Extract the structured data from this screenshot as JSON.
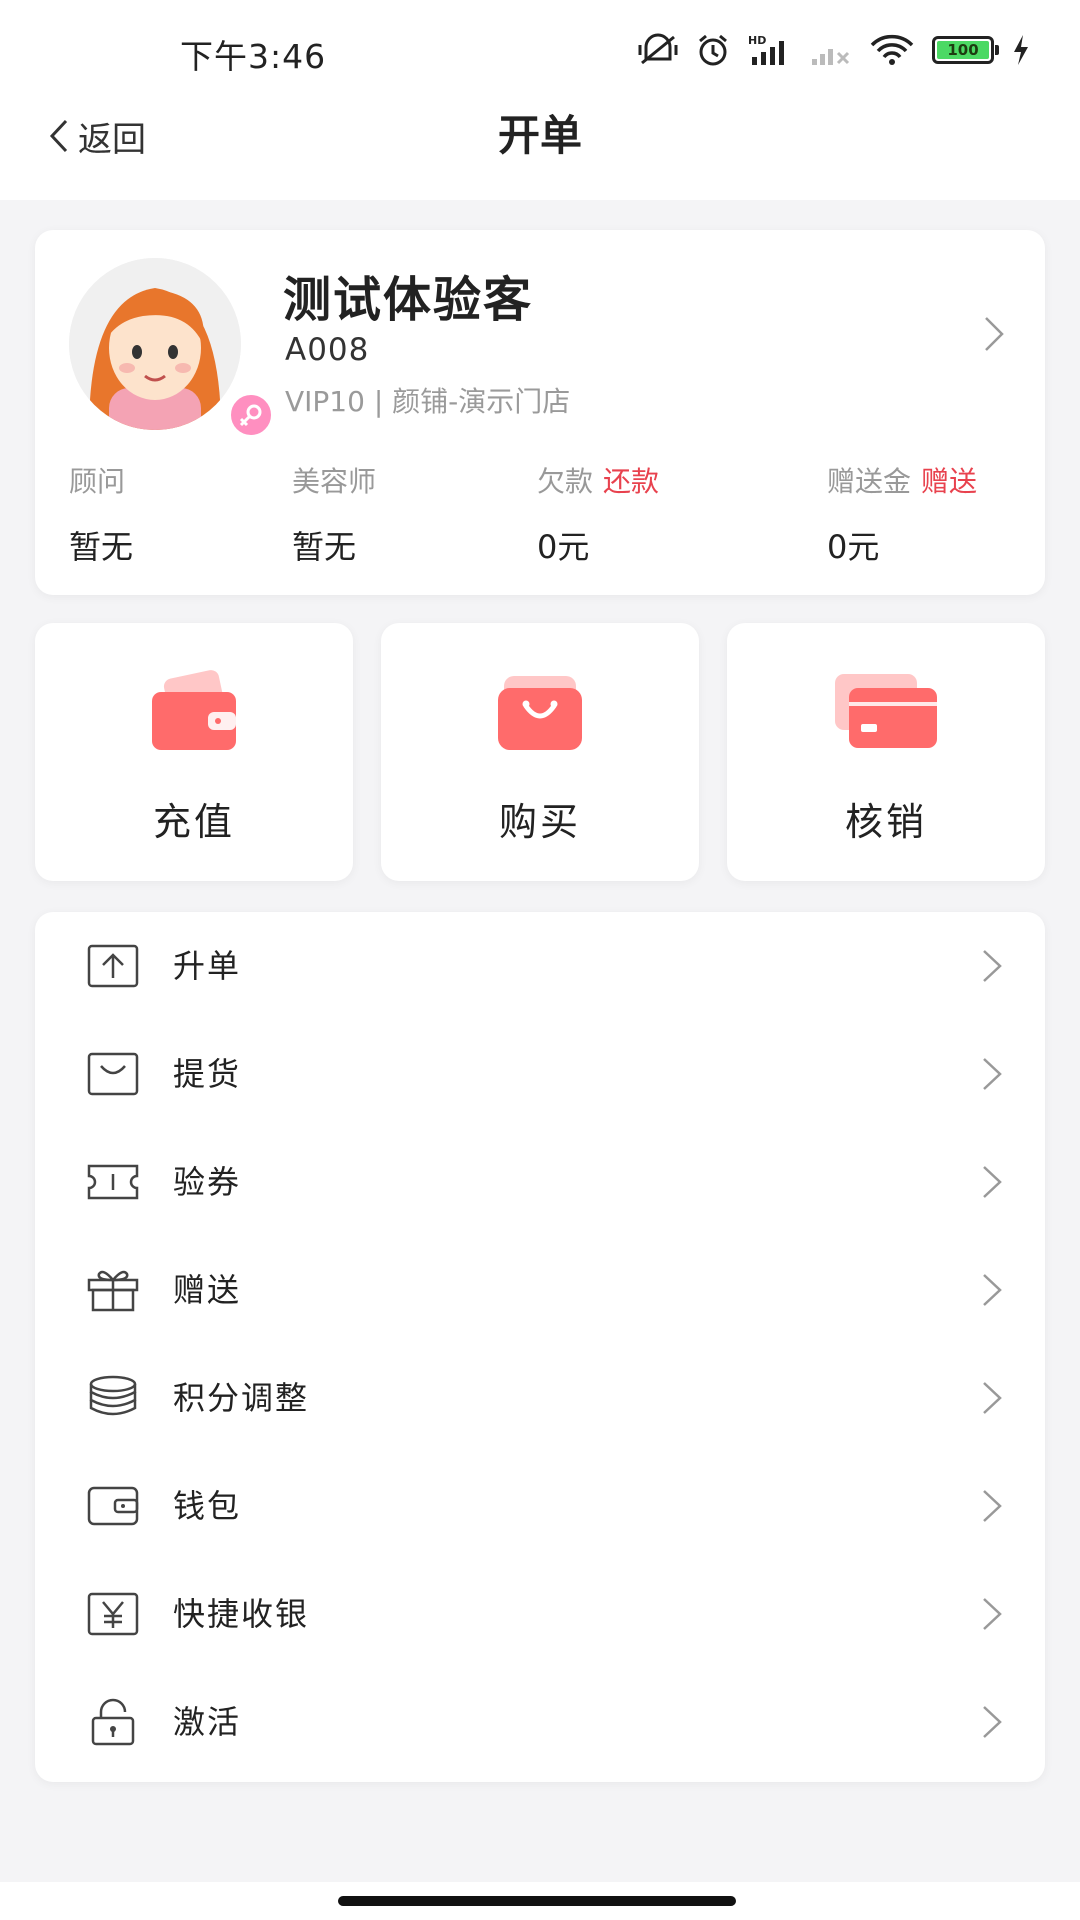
{
  "status_bar": {
    "time": "下午3:46",
    "battery": "100",
    "signal_label": "HD"
  },
  "nav": {
    "back_label": "返回",
    "title": "开单"
  },
  "profile": {
    "name": "测试体验客",
    "code": "A008",
    "level_store": "VIP10 | 颜铺-演示门店",
    "stats": [
      {
        "label": "顾问",
        "value": "暂无",
        "link": ""
      },
      {
        "label": "美容师",
        "value": "暂无",
        "link": ""
      },
      {
        "label": "欠款",
        "value": "0元",
        "link": "还款"
      },
      {
        "label": "赠送金",
        "value": "0元",
        "link": "赠送"
      }
    ]
  },
  "actions": [
    {
      "label": "充值",
      "icon": "wallet-icon"
    },
    {
      "label": "购买",
      "icon": "shopping-bag-icon"
    },
    {
      "label": "核销",
      "icon": "card-icon"
    }
  ],
  "menu": [
    {
      "label": "升单",
      "icon": "upgrade-icon"
    },
    {
      "label": "提货",
      "icon": "bag-icon"
    },
    {
      "label": "验券",
      "icon": "ticket-icon"
    },
    {
      "label": "赠送",
      "icon": "gift-icon"
    },
    {
      "label": "积分调整",
      "icon": "coins-icon"
    },
    {
      "label": "钱包",
      "icon": "wallet-outline-icon"
    },
    {
      "label": "快捷收银",
      "icon": "yuan-icon"
    },
    {
      "label": "激活",
      "icon": "unlock-icon"
    }
  ],
  "colors": {
    "accent_red": "#e8424e",
    "icon_coral": "#ff6b6b",
    "background": "#f4f4f6"
  }
}
